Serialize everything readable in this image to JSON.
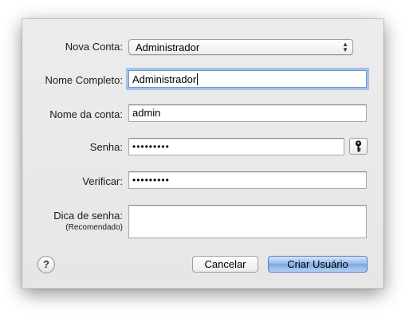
{
  "form": {
    "account_type_label": "Nova Conta:",
    "account_type_value": "Administrador",
    "full_name_label": "Nome Completo:",
    "full_name_value": "Administrador",
    "account_name_label": "Nome da conta:",
    "account_name_value": "admin",
    "password_label": "Senha:",
    "password_value": "•••••••••",
    "verify_label": "Verificar:",
    "verify_value": "•••••••••",
    "hint_label": "Dica de senha:",
    "hint_sublabel": "(Recomendado)",
    "hint_value": ""
  },
  "buttons": {
    "help": "?",
    "cancel": "Cancelar",
    "create": "Criar Usuário"
  },
  "icons": {
    "popup_arrows": "updown-arrows-icon",
    "password_assistant": "key-icon"
  },
  "colors": {
    "sheet_background": "#e6e6e6",
    "focus_ring": "#6ea0e6",
    "default_button": "#7aa6e4"
  }
}
